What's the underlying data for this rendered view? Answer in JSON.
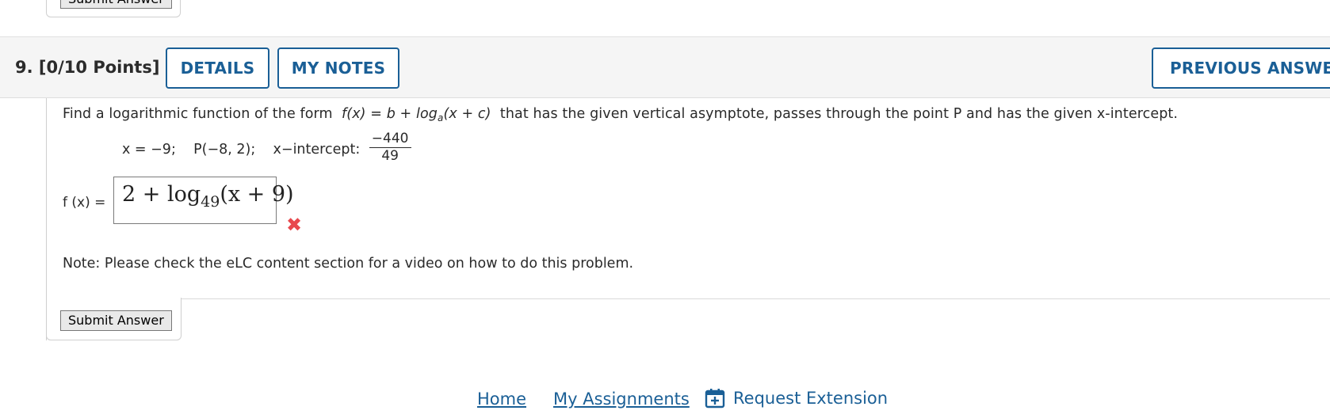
{
  "prev_question": {
    "submit_label": "Submit Answer"
  },
  "header": {
    "number": "9.",
    "points": "[0/10 Points]",
    "details_label": "DETAILS",
    "notes_label": "MY NOTES",
    "previous_answers_label": "PREVIOUS ANSWERS"
  },
  "question": {
    "prompt_prefix": "Find a logarithmic function of the form",
    "form": {
      "lhs": "f(x)",
      "rhs_b": "b + log",
      "sub_a": "a",
      "rhs_rest": "(x + c)"
    },
    "prompt_suffix": "that has the given vertical asymptote, passes through the point P and has the given x-intercept.",
    "asymptote": "x = −9;",
    "point": "P(−8, 2);",
    "intercept_label": "x−intercept:",
    "intercept_num": "−440",
    "intercept_den": "49"
  },
  "answer": {
    "label": "f (x) =",
    "value_main": "2 + log",
    "value_base": "49",
    "value_arg": "(x + 9)",
    "status": "incorrect",
    "status_icon": "x-mark-icon",
    "status_color": "#e8494e"
  },
  "note": "Note: Please check the eLC content section for a video on how to do this problem.",
  "submit_label": "Submit Answer",
  "footer": {
    "home": "Home",
    "assignments": "My Assignments",
    "extension": "Request Extension"
  },
  "colors": {
    "accent": "#1a5f96",
    "header_bg": "#f5f5f5",
    "error": "#e8494e"
  }
}
